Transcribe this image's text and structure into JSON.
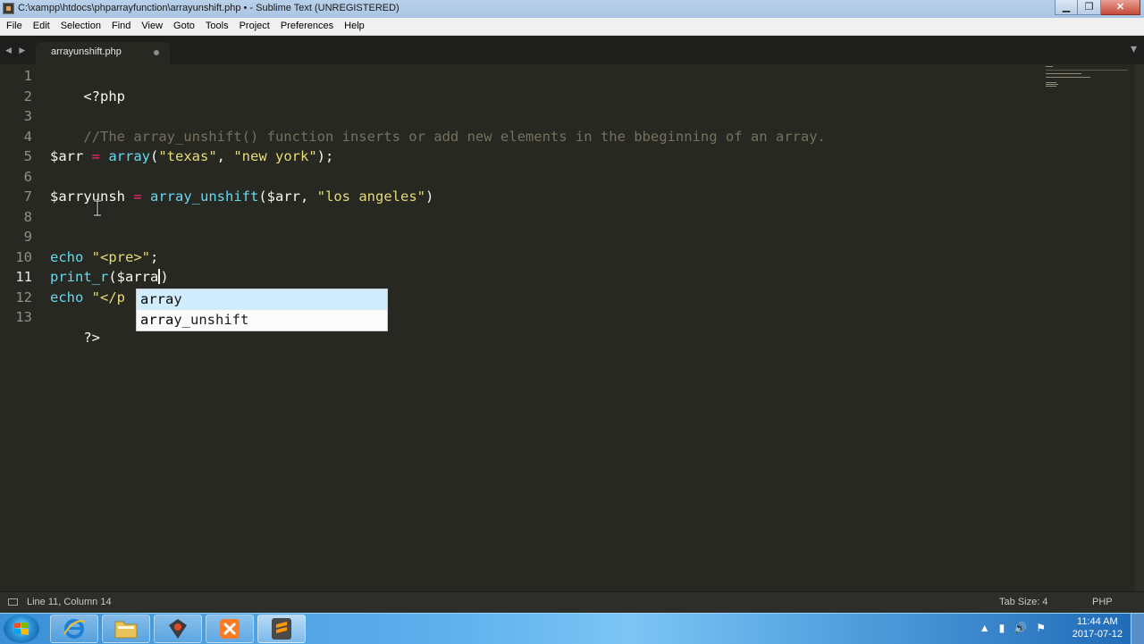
{
  "window": {
    "title": "C:\\xampp\\htdocs\\phparrayfunction\\arrayunshift.php • - Sublime Text (UNREGISTERED)",
    "minimize": "▁",
    "maximize": "❐",
    "close": "✕"
  },
  "menu": [
    "File",
    "Edit",
    "Selection",
    "Find",
    "View",
    "Goto",
    "Tools",
    "Project",
    "Preferences",
    "Help"
  ],
  "tab": {
    "label": "arrayunshift.php",
    "nav": "◀ ▶",
    "plus": "▾"
  },
  "line_numbers": [
    "1",
    "2",
    "3",
    "4",
    "5",
    "6",
    "7",
    "8",
    "9",
    "10",
    "11",
    "12",
    "13"
  ],
  "current_line": 11,
  "code": {
    "l1": "<?php",
    "l3": "//The array_unshift() function inserts or add new elements in the bbeginning of an array.",
    "l5": {
      "var": "$arr",
      "eq": " = ",
      "fn": "array",
      "open": "(",
      "s1": "\"texas\"",
      "comma": ", ",
      "s2": "\"new york\"",
      "close": ");"
    },
    "l7": {
      "var": "$arryunsh",
      "eq": " = ",
      "fn": "array_unshift",
      "open": "(",
      "arg": "$arr",
      "comma": ", ",
      "s1": "\"los angeles\"",
      "close": ")"
    },
    "l10": {
      "kw": "echo",
      "sp": " ",
      "s1": "\"<pre>\"",
      "end": ";"
    },
    "l11": {
      "fn": "print_r",
      "open": "(",
      "arg": "$arra",
      "close": ")"
    },
    "l12": {
      "kw": "echo",
      "sp": " ",
      "s1": "\"</p"
    },
    "l13": "?>"
  },
  "autocomplete": {
    "options": [
      {
        "match": "arra",
        "rest": "y"
      },
      {
        "match": "arra",
        "rest": "y_unshift"
      }
    ],
    "selected": 0
  },
  "status": {
    "position": "Line 11, Column 14",
    "tab_size": "Tab Size: 4",
    "syntax": "PHP"
  },
  "taskbar": {
    "apps": [
      "internet-explorer",
      "file-explorer",
      "app-tool",
      "xampp",
      "sublime-text"
    ],
    "time": "11:44 AM",
    "date": "2017-07-12"
  }
}
